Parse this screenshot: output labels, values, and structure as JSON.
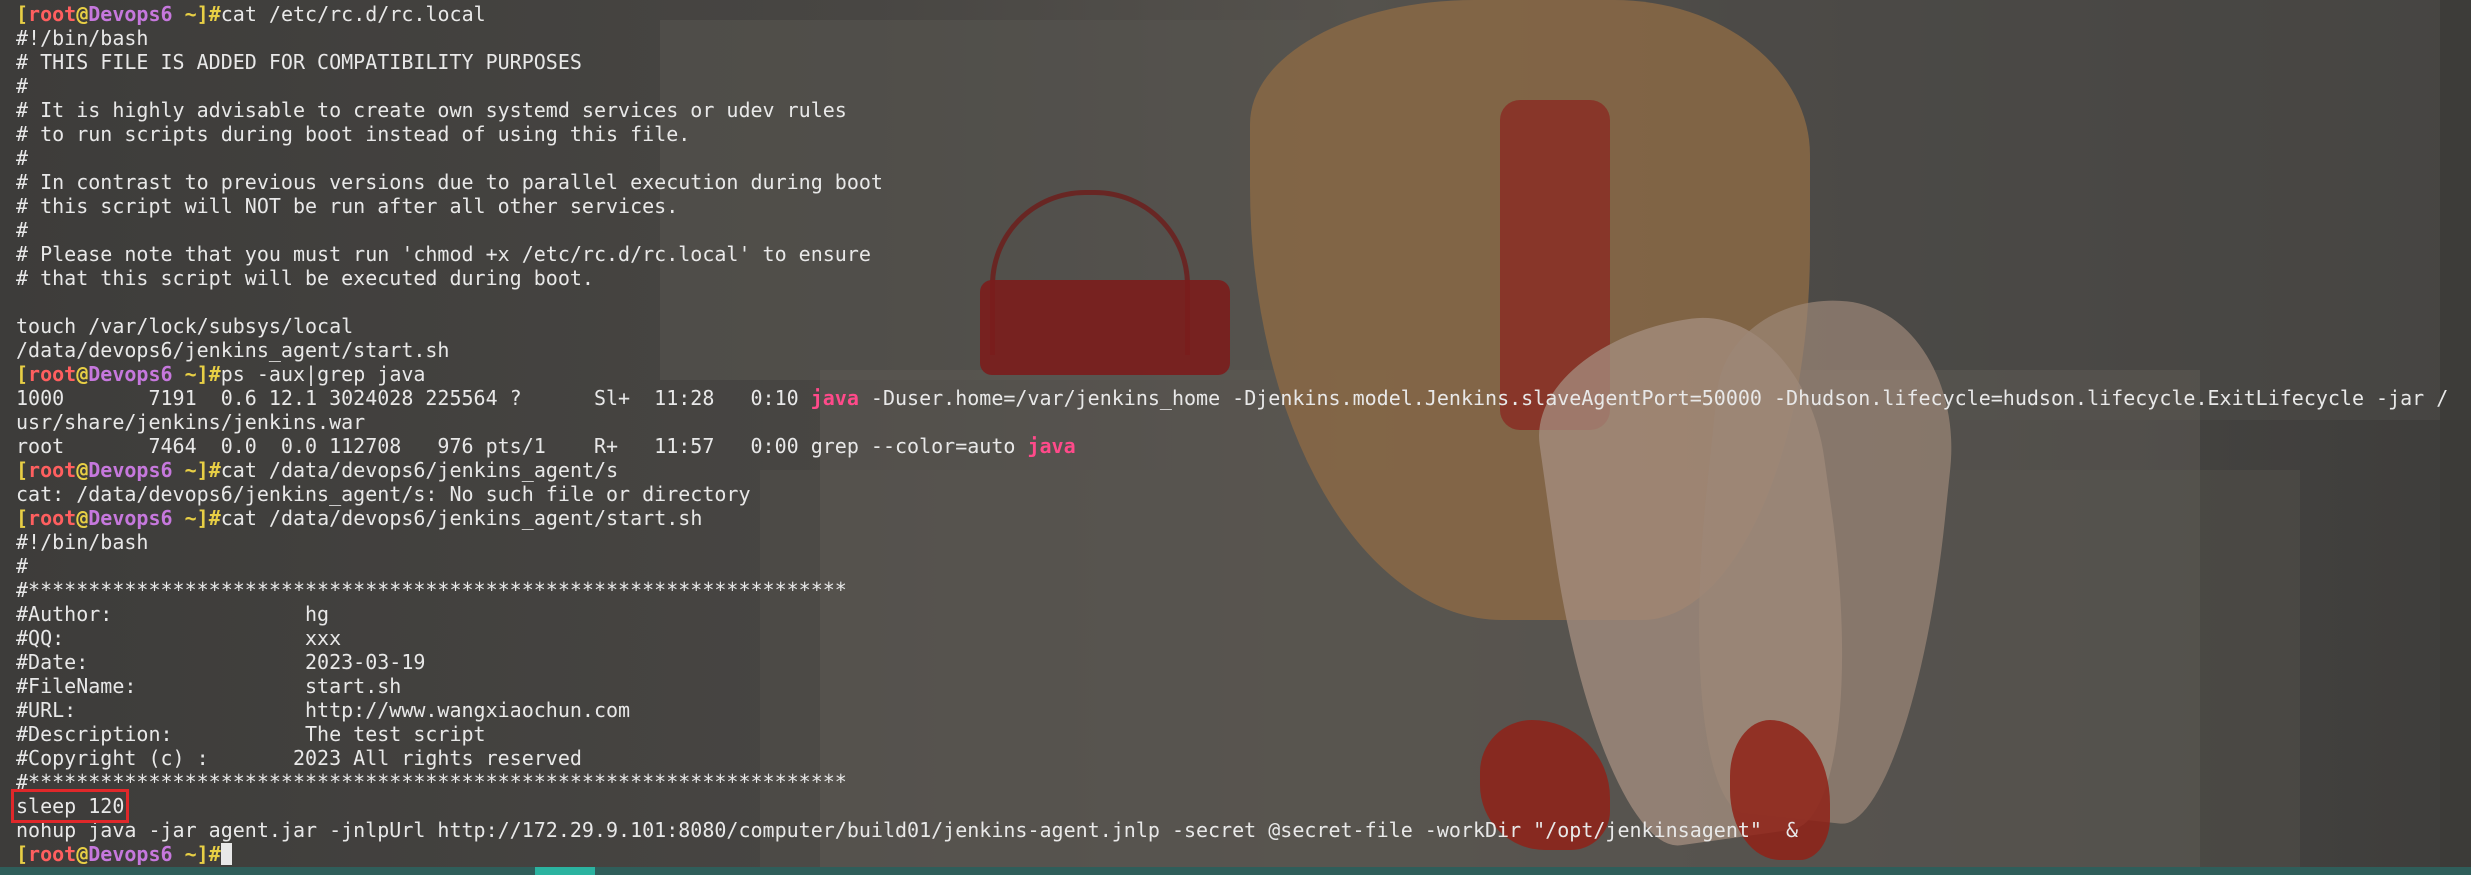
{
  "prompt": {
    "user": "root",
    "at": "@",
    "host": "Devops6",
    "dir": "~",
    "symbol": "#",
    "open": "[",
    "close": "]"
  },
  "lines": [
    {
      "type": "prompt",
      "cmd": "cat /etc/rc.d/rc.local"
    },
    {
      "type": "text",
      "text": "#!/bin/bash"
    },
    {
      "type": "text",
      "text": "# THIS FILE IS ADDED FOR COMPATIBILITY PURPOSES"
    },
    {
      "type": "text",
      "text": "#"
    },
    {
      "type": "text",
      "text": "# It is highly advisable to create own systemd services or udev rules"
    },
    {
      "type": "text",
      "text": "# to run scripts during boot instead of using this file."
    },
    {
      "type": "text",
      "text": "#"
    },
    {
      "type": "text",
      "text": "# In contrast to previous versions due to parallel execution during boot"
    },
    {
      "type": "text",
      "text": "# this script will NOT be run after all other services."
    },
    {
      "type": "text",
      "text": "#"
    },
    {
      "type": "text",
      "text": "# Please note that you must run 'chmod +x /etc/rc.d/rc.local' to ensure"
    },
    {
      "type": "text",
      "text": "# that this script will be executed during boot."
    },
    {
      "type": "text",
      "text": ""
    },
    {
      "type": "text",
      "text": "touch /var/lock/subsys/local"
    },
    {
      "type": "text",
      "text": "/data/devops6/jenkins_agent/start.sh"
    },
    {
      "type": "prompt",
      "cmd": "ps -aux|grep java"
    },
    {
      "type": "match",
      "before": "1000       7191  0.6 12.1 3024028 225564 ?      Sl+  11:28   0:10 ",
      "match": "java",
      "after": " -Duser.home=/var/jenkins_home -Djenkins.model.Jenkins.slaveAgentPort=50000 -Dhudson.lifecycle=hudson.lifecycle.ExitLifecycle -jar /"
    },
    {
      "type": "text",
      "text": "usr/share/jenkins/jenkins.war"
    },
    {
      "type": "match",
      "before": "root       7464  0.0  0.0 112708   976 pts/1    R+   11:57   0:00 grep --color=auto ",
      "match": "java",
      "after": ""
    },
    {
      "type": "prompt",
      "cmd": "cat /data/devops6/jenkins_agent/s"
    },
    {
      "type": "text",
      "text": "cat: /data/devops6/jenkins_agent/s: No such file or directory"
    },
    {
      "type": "prompt",
      "cmd": "cat /data/devops6/jenkins_agent/start.sh"
    },
    {
      "type": "text",
      "text": "#!/bin/bash"
    },
    {
      "type": "text",
      "text": "#"
    },
    {
      "type": "text",
      "text": "#********************************************************************"
    },
    {
      "type": "text",
      "text": "#Author:                hg"
    },
    {
      "type": "text",
      "text": "#QQ:                    xxx"
    },
    {
      "type": "text",
      "text": "#Date:                  2023-03-19"
    },
    {
      "type": "text",
      "text": "#FileName:              start.sh"
    },
    {
      "type": "text",
      "text": "#URL:                   http://www.wangxiaochun.com"
    },
    {
      "type": "text",
      "text": "#Description:           The test script"
    },
    {
      "type": "text",
      "text": "#Copyright (c) :       2023 All rights reserved"
    },
    {
      "type": "text",
      "text": "#********************************************************************"
    },
    {
      "type": "boxed",
      "text": "sleep 120"
    },
    {
      "type": "text",
      "text": "nohup java -jar agent.jar -jnlpUrl http://172.29.9.101:8080/computer/build01/jenkins-agent.jnlp -secret @secret-file -workDir \"/opt/jenkinsagent\"  &"
    },
    {
      "type": "prompt",
      "cmd": "",
      "cursor": true
    }
  ]
}
